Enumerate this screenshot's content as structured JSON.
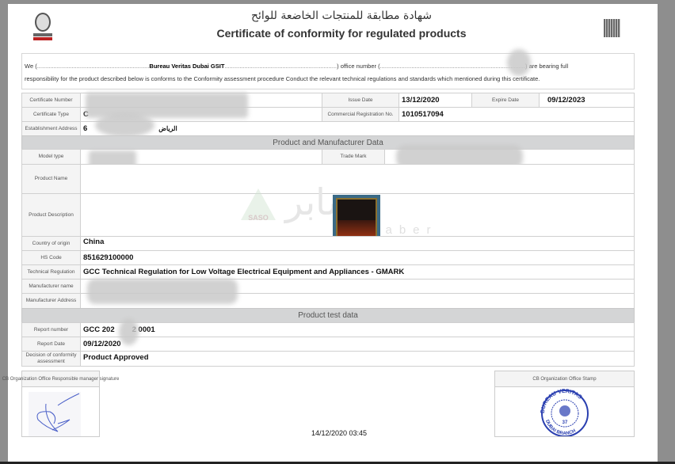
{
  "header": {
    "title_ar": "شهادة مطابقة للمنتجات الخاضعة للوائح",
    "title_en": "Certificate of conformity for regulated products",
    "logo_text": "BUREAU VERITAS"
  },
  "intro": {
    "we": "We (",
    "dots1": "....................................................................",
    "company": "Bureau Veritas Dubai GSIT",
    "dots2": "....................................................................",
    "office": ") office number (",
    "dots3": "........................................................................................",
    "bearing": ") are bearing full",
    "line2": "responsibility for the product described below is conforms to the Conformity assessment procedure Conduct the relevant technical regulations and standards which mentioned during this certificate."
  },
  "cert": {
    "number_label": "Certificate Number",
    "issue_label": "Issue Date",
    "issue_value": "13/12/2020",
    "expire_label": "Expire Date",
    "expire_value": "09/12/2023",
    "type_label": "Certificate Type",
    "type_value": "C",
    "crn_label": "Commercial Registration No.",
    "crn_value": "1010517094",
    "addr_label": "Establishment Address",
    "addr_value": "6",
    "addr_ar": "الرياض"
  },
  "product": {
    "section": "Product and Manufacturer Data",
    "model_label": "Model type",
    "trade_label": "Trade Mark",
    "name_label": "Product Name",
    "desc_label": "Product Description",
    "country_label": "Country of origin",
    "country_value": "China",
    "hs_label": "HS Code",
    "hs_value": "851629100000",
    "tech_label": "Technical Regulation",
    "tech_value": "GCC Technical Regulation for Low Voltage Electrical Equipment and Appliances - GMARK",
    "mname_label": "Manufacturer name",
    "maddr_label": "Manufacturer Address"
  },
  "test": {
    "section": "Product test data",
    "report_label": "Report number",
    "report_value_a": "GCC 202",
    "report_value_b": "2 0001",
    "date_label": "Report Date",
    "date_value": "09/12/2020",
    "decision_label": "Decision of conformity assessment",
    "decision_value": "Product Approved"
  },
  "footer": {
    "signature_label": "CB Organization Office Responsible manager signature",
    "stamp_label": "CB Organization Office Stamp",
    "timestamp": "14/12/2020 03:45",
    "stamp_text_top": "BUREAU VERITAS",
    "stamp_text_bottom": "DUBAI BRANCH",
    "stamp_number": "37"
  },
  "watermark": {
    "saso": "SASO",
    "saber": "saber"
  }
}
